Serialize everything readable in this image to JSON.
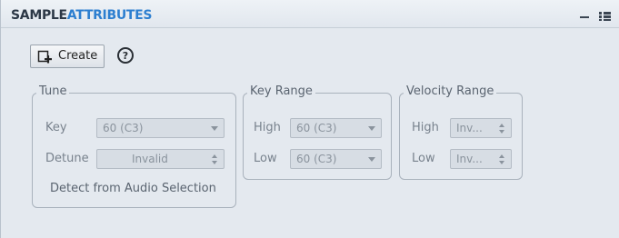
{
  "window": {
    "title_part1": "SAMPLE",
    "title_part2": "ATTRIBUTES",
    "more_glyph": "⋮"
  },
  "toolbar": {
    "create_label": "Create",
    "help_glyph": "?"
  },
  "tune": {
    "legend": "Tune",
    "key_label": "Key",
    "key_value": "60 (C3)",
    "detune_label": "Detune",
    "detune_value": "Invalid",
    "detect_label": "Detect from Audio Selection"
  },
  "key_range": {
    "legend": "Key Range",
    "high_label": "High",
    "high_value": "60 (C3)",
    "low_label": "Low",
    "low_value": "60 (C3)"
  },
  "velocity_range": {
    "legend": "Velocity Range",
    "high_label": "High",
    "high_value": "Inv...",
    "low_label": "Low",
    "low_value": "Inv..."
  },
  "icons": {
    "create": "create-icon",
    "help": "help-icon",
    "minimize": "minimize-icon",
    "menu": "menu-icon",
    "more": "more-icon"
  },
  "colors": {
    "title_dark": "#2c3846",
    "title_accent": "#2d7fd0",
    "panel_bg": "#e4e9ef"
  }
}
